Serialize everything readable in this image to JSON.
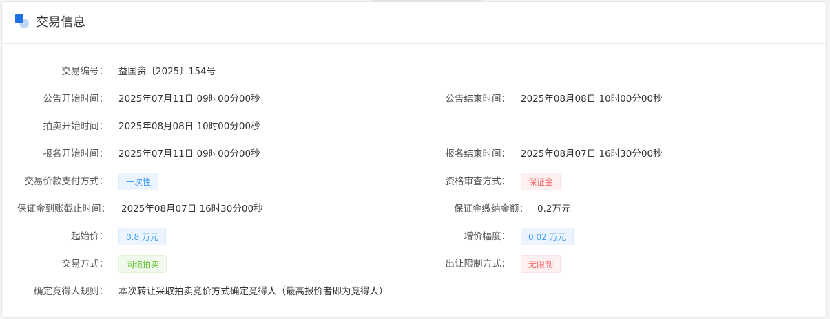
{
  "header": {
    "title": "交易信息"
  },
  "fields": {
    "trade_no": {
      "label": "交易编号：",
      "value": "益国资〔2025〕154号"
    },
    "notice_start": {
      "label": "公告开始时间：",
      "value": "2025年07月11日 09时00分00秒"
    },
    "notice_end": {
      "label": "公告结束时间：",
      "value": "2025年08月08日 10时00分00秒"
    },
    "auction_start": {
      "label": "拍卖开始时间：",
      "value": "2025年08月08日 10时00分00秒"
    },
    "signup_start": {
      "label": "报名开始时间：",
      "value": "2025年07月11日 09时00分00秒"
    },
    "signup_end": {
      "label": "报名结束时间：",
      "value": "2025年08月07日 16时30分00秒"
    },
    "payment_method": {
      "label": "交易价款支付方式：",
      "value": "一次性"
    },
    "qualification_method": {
      "label": "资格审查方式：",
      "value": "保证金"
    },
    "deposit_deadline": {
      "label": "保证金到账截止时间：",
      "value": "2025年08月07日 16时30分00秒"
    },
    "deposit_amount": {
      "label": "保证金缴纳金额：",
      "value": "0.2万元"
    },
    "start_price": {
      "label": "起始价：",
      "value": "0.8 万元"
    },
    "increment": {
      "label": "增价幅度：",
      "value": "0.02 万元"
    },
    "trade_method": {
      "label": "交易方式：",
      "value": "网络拍卖"
    },
    "transfer_limit": {
      "label": "出让限制方式：",
      "value": "无限制"
    },
    "winner_rule": {
      "label": "确定竞得人规则：",
      "value": "本次转让采取拍卖竞价方式确定竞得人（最高报价者即为竞得人）"
    }
  },
  "colors": {
    "accent_blue": "#409eff",
    "tag_red": "#f56c6c",
    "tag_green": "#67c23a",
    "icon_blue": "#1f6fe5"
  },
  "icons": {
    "header": "section-square-icon"
  }
}
